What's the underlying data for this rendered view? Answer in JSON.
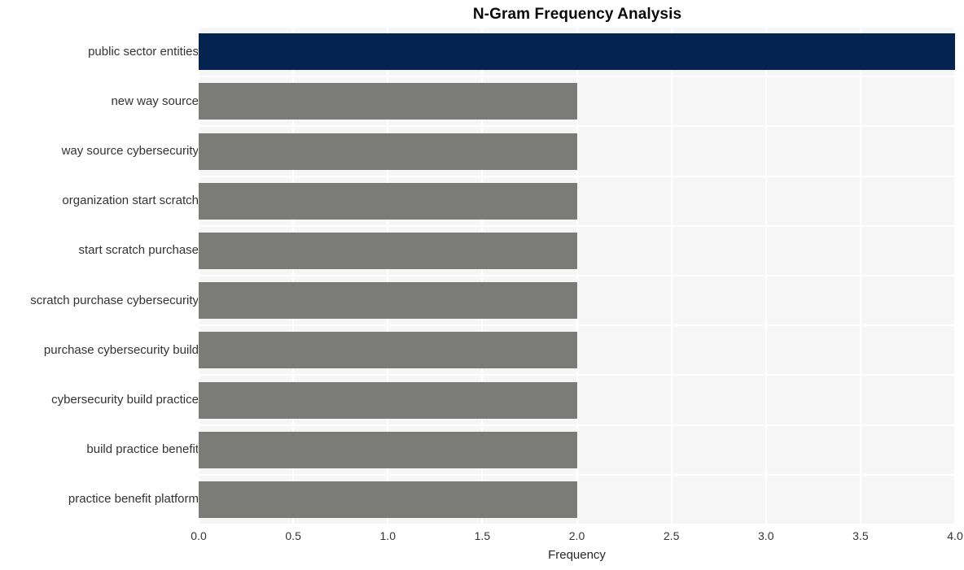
{
  "chart_data": {
    "type": "bar",
    "orientation": "horizontal",
    "title": "N-Gram Frequency Analysis",
    "xlabel": "Frequency",
    "ylabel": "",
    "categories": [
      "public sector entities",
      "new way source",
      "way source cybersecurity",
      "organization start scratch",
      "start scratch purchase",
      "scratch purchase cybersecurity",
      "purchase cybersecurity build",
      "cybersecurity build practice",
      "build practice benefit",
      "practice benefit platform"
    ],
    "values": [
      4,
      2,
      2,
      2,
      2,
      2,
      2,
      2,
      2,
      2
    ],
    "bar_colors": [
      "#04244f",
      "#7b7b77",
      "#7b7b77",
      "#7b7b77",
      "#7b7b77",
      "#7b7b77",
      "#7b7b77",
      "#7b7b77",
      "#7b7b77",
      "#7b7b77"
    ],
    "xlim": [
      0,
      4
    ],
    "xticks": [
      0.0,
      0.5,
      1.0,
      1.5,
      2.0,
      2.5,
      3.0,
      3.5,
      4.0
    ],
    "xtick_labels": [
      "0.0",
      "0.5",
      "1.0",
      "1.5",
      "2.0",
      "2.5",
      "3.0",
      "3.5",
      "4.0"
    ],
    "grid": true,
    "grid_color": "#ffffff",
    "plot_background": "#f6f6f7",
    "figure_background": "#ffffff",
    "legend": null,
    "highlight_color": "#04244f",
    "default_bar_color": "#7b7b77"
  }
}
